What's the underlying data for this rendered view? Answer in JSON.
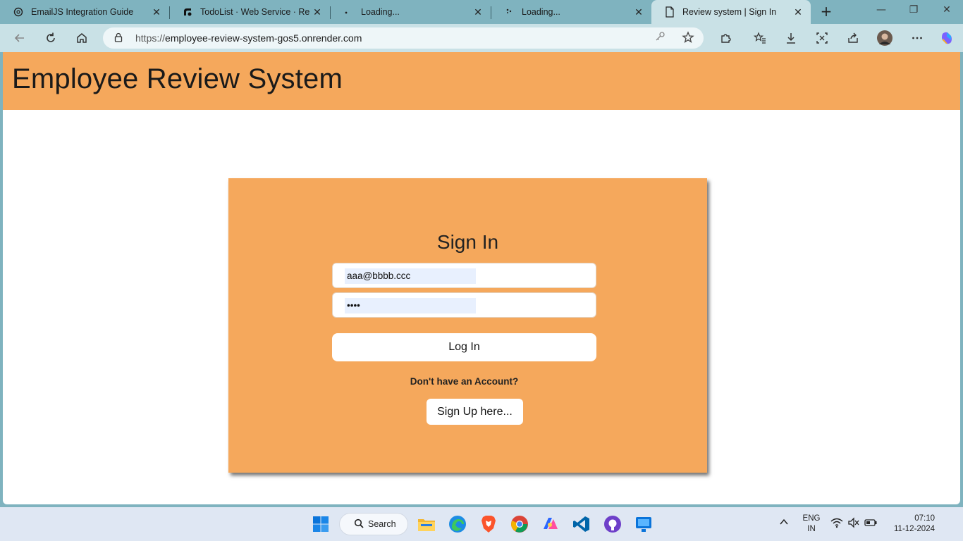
{
  "browser": {
    "tabs": [
      {
        "title": "EmailJS Integration Guide",
        "icon": "openai-icon"
      },
      {
        "title": "TodoList · Web Service · Rende",
        "icon": "render-icon"
      },
      {
        "title": "Loading...",
        "icon": "loading-icon"
      },
      {
        "title": "Loading...",
        "icon": "loading-icon"
      },
      {
        "title": "Review system | Sign In",
        "icon": "page-icon"
      }
    ],
    "url_scheme": "https://",
    "url_host": "employee-review-system-gos5.onrender.com"
  },
  "page": {
    "site_title": "Employee Review System",
    "signin": {
      "title": "Sign In",
      "email_value": "aaa@bbbb.ccc",
      "password_value": "••••",
      "login_label": "Log In",
      "no_account_text": "Don't have an Account?",
      "signup_label": "Sign Up here..."
    }
  },
  "colors": {
    "accent": "#f5a85c",
    "tabstrip": "#7fb3bf",
    "toolbar": "#c9e1e6"
  },
  "taskbar": {
    "search_label": "Search",
    "lang_line1": "ENG",
    "lang_line2": "IN",
    "time": "07:10",
    "date": "11-12-2024"
  }
}
